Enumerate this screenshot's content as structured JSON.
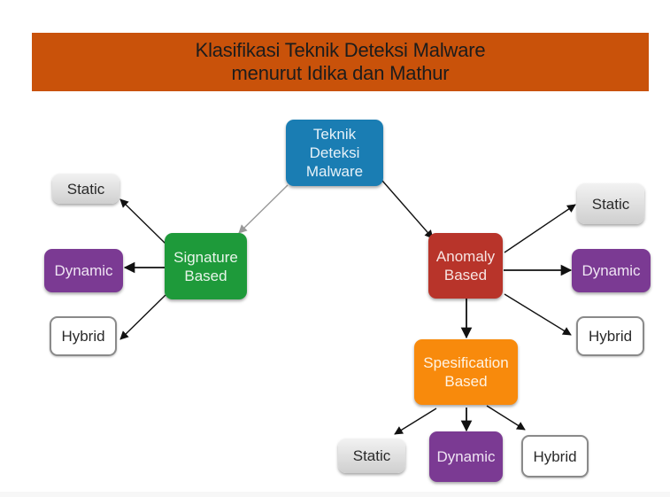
{
  "title": {
    "line1": "Klasifikasi Teknik Deteksi Malware",
    "line2": "menurut Idika dan Mathur",
    "background_color": "#c9520a"
  },
  "nodes": {
    "root": {
      "lines": [
        "Teknik",
        "Deteksi",
        "Malware"
      ],
      "color": "#1a7db3"
    },
    "signature": {
      "lines": [
        "Signature",
        "Based"
      ],
      "color": "#1e9a3a"
    },
    "anomaly": {
      "lines": [
        "Anomaly",
        "Based"
      ],
      "color": "#b8342a"
    },
    "specification": {
      "lines": [
        "Spesification",
        "Based"
      ],
      "color": "#f88a0c"
    },
    "sig_static": {
      "label": "Static"
    },
    "sig_dynamic": {
      "label": "Dynamic"
    },
    "sig_hybrid": {
      "label": "Hybrid"
    },
    "anom_static": {
      "label": "Static"
    },
    "anom_dynamic": {
      "label": "Dynamic"
    },
    "anom_hybrid": {
      "label": "Hybrid"
    },
    "spec_static": {
      "label": "Static"
    },
    "spec_dynamic": {
      "label": "Dynamic"
    },
    "spec_hybrid": {
      "label": "Hybrid"
    }
  },
  "edges": [
    {
      "from": "root",
      "to": "signature",
      "style": "gray"
    },
    {
      "from": "root",
      "to": "anomaly"
    },
    {
      "from": "signature",
      "to": "sig_static"
    },
    {
      "from": "signature",
      "to": "sig_dynamic"
    },
    {
      "from": "signature",
      "to": "sig_hybrid"
    },
    {
      "from": "anomaly",
      "to": "anom_static"
    },
    {
      "from": "anomaly",
      "to": "anom_dynamic"
    },
    {
      "from": "anomaly",
      "to": "anom_hybrid"
    },
    {
      "from": "anomaly",
      "to": "specification"
    },
    {
      "from": "specification",
      "to": "spec_static"
    },
    {
      "from": "specification",
      "to": "spec_dynamic"
    },
    {
      "from": "specification",
      "to": "spec_hybrid"
    }
  ]
}
